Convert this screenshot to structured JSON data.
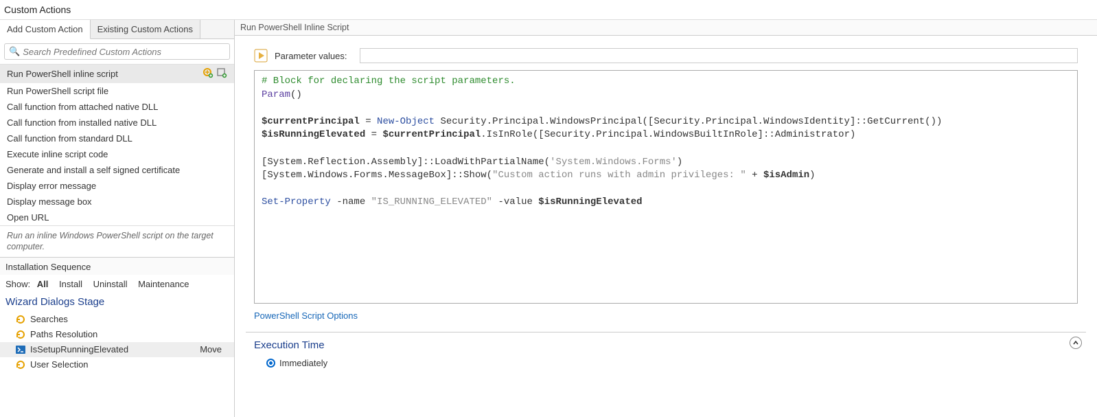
{
  "title": "Custom Actions",
  "tabs": {
    "add": "Add Custom Action",
    "existing": "Existing Custom Actions"
  },
  "search": {
    "placeholder": "Search Predefined Custom Actions"
  },
  "actions": {
    "items": [
      "Run PowerShell inline script",
      "Run PowerShell script file",
      "Call function from attached native DLL",
      "Call function from installed native DLL",
      "Call function from standard DLL",
      "Execute inline script code",
      "Generate and install a self signed certificate",
      "Display error message",
      "Display message box",
      "Open URL"
    ],
    "selected_index": 0
  },
  "description": "Run an inline Windows PowerShell script on the target computer.",
  "sequence": {
    "header": "Installation Sequence",
    "show_label": "Show:",
    "filters": [
      "All",
      "Install",
      "Uninstall",
      "Maintenance"
    ],
    "active_filter": 0,
    "stage_title": "Wizard Dialogs Stage",
    "nodes": [
      {
        "label": "Searches",
        "icon": "refresh",
        "selected": false,
        "move": ""
      },
      {
        "label": "Paths Resolution",
        "icon": "refresh",
        "selected": false,
        "move": ""
      },
      {
        "label": "IsSetupRunningElevated",
        "icon": "ps",
        "selected": true,
        "move": "Move"
      },
      {
        "label": "User Selection",
        "icon": "refresh",
        "selected": false,
        "move": ""
      }
    ]
  },
  "editor": {
    "tab_title": "Run PowerShell Inline Script",
    "param_label": "Parameter values:",
    "param_value": "",
    "options_link": "PowerShell Script Options",
    "code": {
      "l1": "# Block for declaring the script parameters.",
      "l2a": "Param",
      "l2b": "()",
      "l3a": "$currentPrincipal",
      "l3b": " = ",
      "l3c": "New-Object",
      "l3d": " Security.Principal.WindowsPrincipal([Security.Principal.WindowsIdentity]::GetCurrent())",
      "l4a": "$isRunningElevated",
      "l4b": " = ",
      "l4c": "$currentPrincipal",
      "l4d": ".IsInRole([Security.Principal.WindowsBuiltInRole]::Administrator)",
      "l5a": "[System.Reflection.Assembly]::LoadWithPartialName(",
      "l5b": "'System.Windows.Forms'",
      "l5c": ")",
      "l6a": "[System.Windows.Forms.MessageBox]::Show(",
      "l6b": "\"Custom action runs with admin privileges: \"",
      "l6c": " + ",
      "l6d": "$isAdmin",
      "l6e": ")",
      "l7a": "Set-Property",
      "l7b": " -name ",
      "l7c": "\"IS_RUNNING_ELEVATED\"",
      "l7d": " -value ",
      "l7e": "$isRunningElevated"
    }
  },
  "exec": {
    "title": "Execution Time",
    "option": "Immediately"
  }
}
